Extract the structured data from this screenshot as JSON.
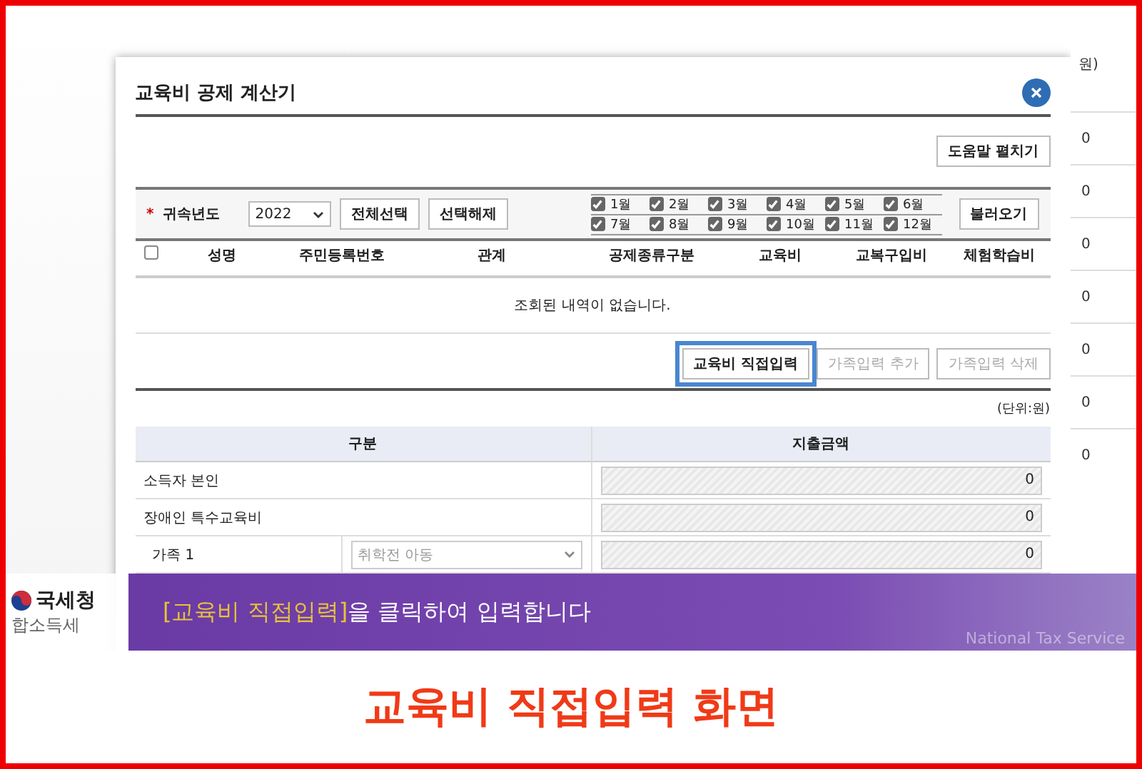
{
  "dialog": {
    "title": "교육비 공제 계산기",
    "help_button": "도움말 펼치기",
    "filter": {
      "required_mark": "*",
      "label": "귀속년도",
      "year": "2022",
      "select_all": "전체선택",
      "deselect": "선택해제",
      "load_button": "불러오기",
      "months": [
        {
          "label": "1월",
          "checked": true
        },
        {
          "label": "2월",
          "checked": true
        },
        {
          "label": "3월",
          "checked": true
        },
        {
          "label": "4월",
          "checked": true
        },
        {
          "label": "5월",
          "checked": true
        },
        {
          "label": "6월",
          "checked": true
        },
        {
          "label": "7월",
          "checked": true
        },
        {
          "label": "8월",
          "checked": true
        },
        {
          "label": "9월",
          "checked": true
        },
        {
          "label": "10월",
          "checked": true
        },
        {
          "label": "11월",
          "checked": true
        },
        {
          "label": "12월",
          "checked": true
        }
      ]
    },
    "table": {
      "select_all_checked": false,
      "columns": [
        "성명",
        "주민등록번호",
        "관계",
        "공제종류구분",
        "교육비",
        "교복구입비",
        "체험학습비"
      ],
      "empty_message": "조회된 내역이 없습니다."
    },
    "actions": [
      {
        "label": "교육비 직접입력",
        "disabled": false,
        "highlighted": true
      },
      {
        "label": "가족입력 추가",
        "disabled": true,
        "highlighted": false
      },
      {
        "label": "가족입력 삭제",
        "disabled": true,
        "highlighted": false
      }
    ],
    "unit": "(단위:원)",
    "expense_table": {
      "columns": [
        "구분",
        "지출금액"
      ],
      "rows": [
        {
          "kind": "single",
          "label": "소득자 본인",
          "amount": "0"
        },
        {
          "kind": "single",
          "label": "장애인 특수교육비",
          "amount": "0"
        },
        {
          "kind": "family",
          "label": "가족 1",
          "type": "취학전 아동",
          "amount": "0"
        }
      ]
    }
  },
  "background_page": {
    "header": "원)",
    "cells": [
      "0",
      "0",
      "0",
      "0",
      "0",
      "0",
      "0"
    ]
  },
  "logo": {
    "name": "국세청",
    "subtitle": "합소득세"
  },
  "caption": {
    "highlight": "[교육비 직접입력]",
    "text": "을 클릭하여 입력합니다"
  },
  "brand_text": "National Tax Service",
  "headline": "교육비 직접입력 화면"
}
